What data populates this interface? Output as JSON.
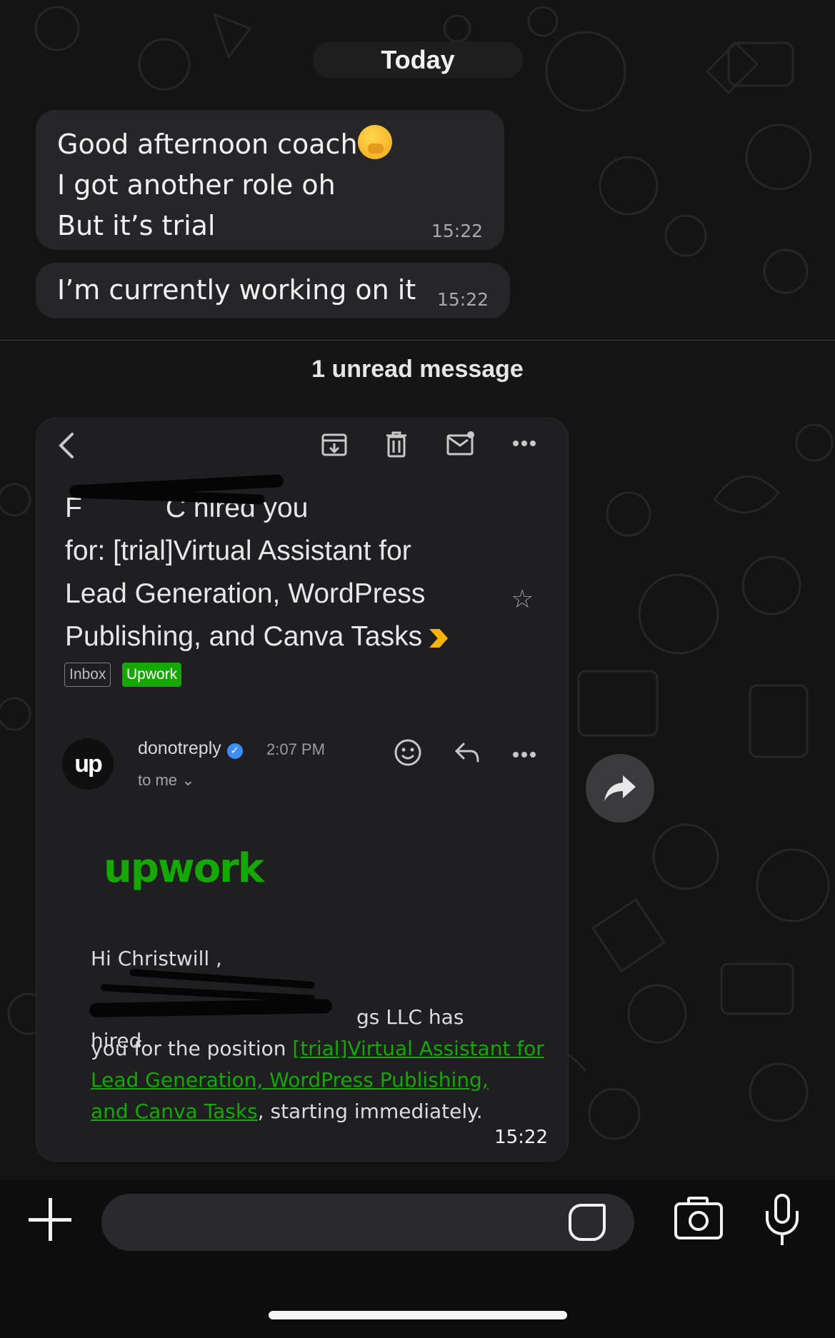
{
  "day_separator": "Today",
  "messages": [
    {
      "lines": [
        "Good afternoon coach",
        "I got another role oh",
        "But it’s trial"
      ],
      "time": "15:22"
    },
    {
      "lines": [
        "I’m currently working on it"
      ],
      "time": "15:22"
    }
  ],
  "unread_banner": "1 unread message",
  "image_message": {
    "time": "15:22",
    "email": {
      "subject_lines": [
        "F               C hired you",
        "for: [trial]Virtual Assistant for",
        "Lead Generation, WordPress",
        "Publishing, and Canva Tasks"
      ],
      "labels": {
        "inbox": "Inbox",
        "upwork": "Upwork"
      },
      "sender": "donotreply",
      "send_time": "2:07 PM",
      "recipient": "to me",
      "logo_text": "upwork",
      "avatar_text": "up",
      "greeting": "Hi Christwill ,",
      "body_line1_tail": "gs LLC has hired",
      "body_line2_prefix": "you for the position ",
      "body_link_1": "[trial]Virtual Assistant for",
      "body_link_2": "Lead Generation, WordPress Publishing,",
      "body_link_3": "and Canva Tasks",
      "body_suffix": ", starting immediately."
    }
  },
  "colors": {
    "upwork_green": "#14a800",
    "bubble": "#262628",
    "verified_blue": "#3e8ef7"
  },
  "icons": [
    "back-arrow-icon",
    "archive-icon",
    "trash-icon",
    "mark-unread-icon",
    "more-icon",
    "star-icon",
    "important-icon",
    "verified-icon",
    "emoji-icon",
    "reply-icon",
    "forward-icon",
    "plus-icon",
    "sticker-icon",
    "camera-icon",
    "microphone-icon"
  ]
}
